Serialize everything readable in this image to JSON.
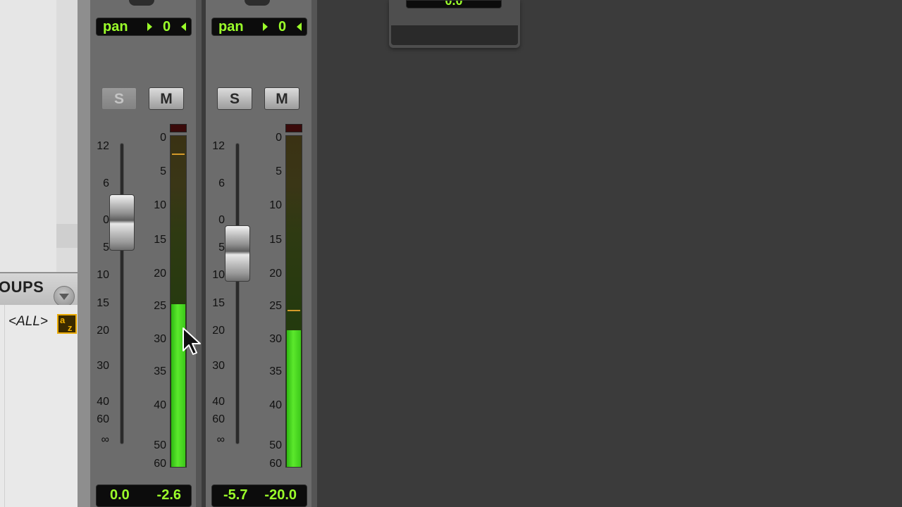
{
  "groups_panel": {
    "title": "OUPS",
    "all_label": "<ALL>",
    "az_icon": "az-sort-icon"
  },
  "floating_panel": {
    "readout": "0.0"
  },
  "channels": [
    {
      "pan_label": "pan",
      "pan_value": "0",
      "solo_label": "S",
      "mute_label": "M",
      "solo_active": false,
      "fader_scale": [
        "12",
        "6",
        "0",
        "5",
        "10",
        "15",
        "20",
        "30",
        "40",
        "60",
        "∞"
      ],
      "meter_scale": [
        "0",
        "5",
        "10",
        "15",
        "20",
        "25",
        "30",
        "35",
        "40",
        "50",
        "60"
      ],
      "meter_level_fraction": 0.49,
      "volume": "0.0",
      "peak": "-2.6"
    },
    {
      "pan_label": "pan",
      "pan_value": "0",
      "solo_label": "S",
      "mute_label": "M",
      "solo_active": true,
      "fader_scale": [
        "12",
        "6",
        "0",
        "5",
        "10",
        "15",
        "20",
        "30",
        "40",
        "60",
        "∞"
      ],
      "meter_scale": [
        "0",
        "5",
        "10",
        "15",
        "20",
        "25",
        "30",
        "35",
        "40",
        "50",
        "60"
      ],
      "meter_level_fraction": 0.41,
      "volume": "-5.7",
      "peak": "-20.0"
    }
  ],
  "colors": {
    "readout_text": "#9bff2a",
    "meter_green": "#3cc81a",
    "peak_hold": "#d49a2a",
    "az_icon": "#f5b400"
  },
  "cursor_icon": "mouse-pointer-icon"
}
